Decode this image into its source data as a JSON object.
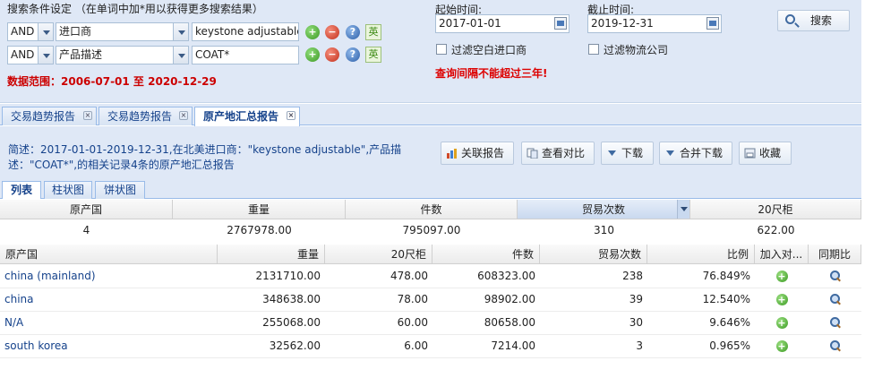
{
  "search": {
    "title": "搜索条件设定 （在单词中加*用以获得更多搜索结果）",
    "rows": [
      {
        "logic": "AND",
        "field": "进口商",
        "value": "keystone adjustable",
        "en_label": "英"
      },
      {
        "logic": "AND",
        "field": "产品描述",
        "value": "COAT*",
        "en_label": "英"
      }
    ],
    "data_range": "数据范围：2006-07-01 至 2020-12-29",
    "start_label": "起始时间:",
    "start_date": "2017-01-01",
    "end_label": "截止时间:",
    "end_date": "2019-12-31",
    "filter_blank_importer": "过滤空白进口商",
    "filter_logistics": "过滤物流公司",
    "warning": "查询间隔不能超过三年!",
    "search_button": "搜索"
  },
  "tabs": [
    {
      "label": "交易趋势报告"
    },
    {
      "label": "交易趋势报告"
    },
    {
      "label": "原产地汇总报告"
    }
  ],
  "summary": "简述：2017-01-01-2019-12-31,在北美进口商：\"keystone adjustable\",产品描述：\"COAT*\",的相关记录4条的原产地汇总报告",
  "actions": {
    "related": "关联报告",
    "compare": "查看对比",
    "download": "下载",
    "merge_download": "合并下载",
    "favorite": "收藏"
  },
  "view_tabs": [
    "列表",
    "柱状图",
    "饼状图"
  ],
  "totals": {
    "headers": [
      "原产国",
      "重量",
      "件数",
      "贸易次数",
      "20尺柜"
    ],
    "values": [
      "4",
      "2767978.00",
      "795097.00",
      "310",
      "622.00"
    ]
  },
  "detail": {
    "headers": [
      "原产国",
      "重量",
      "20尺柜",
      "件数",
      "贸易次数",
      "比例",
      "加入对...",
      "同期比"
    ],
    "rows": [
      {
        "country": "china (mainland)",
        "weight": "2131710.00",
        "teu": "478.00",
        "pieces": "608323.00",
        "trades": "238",
        "ratio": "76.849%"
      },
      {
        "country": "china",
        "weight": "348638.00",
        "teu": "78.00",
        "pieces": "98902.00",
        "trades": "39",
        "ratio": "12.540%"
      },
      {
        "country": "N/A",
        "weight": "255068.00",
        "teu": "60.00",
        "pieces": "80658.00",
        "trades": "30",
        "ratio": "9.646%"
      },
      {
        "country": "south korea",
        "weight": "32562.00",
        "teu": "6.00",
        "pieces": "7214.00",
        "trades": "3",
        "ratio": "0.965%"
      }
    ]
  }
}
